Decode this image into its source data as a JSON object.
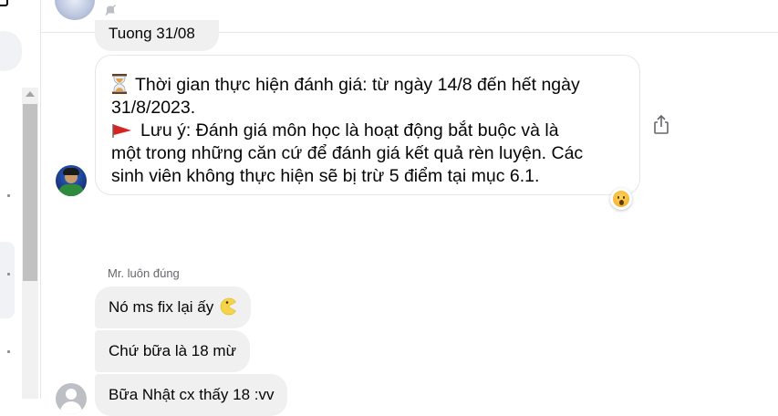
{
  "conversation": {
    "prev_message_partial": "Tuong 31/08"
  },
  "announcement": {
    "line1": "Thời gian thực hiện đánh giá: từ ngày 14/8 đến hết ngày",
    "line2": "31/8/2023.",
    "line3": "Lưu ý: Đánh giá môn học là hoạt động bắt buộc và là",
    "line4": "một trong những căn cứ để đánh giá kết quả rèn luyện. Các",
    "line5": "sinh viên không thực hiện sẽ bị trừ 5 điểm tại mục 6.1.",
    "reaction": "wow"
  },
  "reply_group": {
    "sender_name": "Mr. luôn đúng",
    "messages": [
      {
        "text": "Nó ms fix lại ấy",
        "emoji": "pacman"
      },
      {
        "text": "Chứ bữa là 18 mừ"
      },
      {
        "text": "Bữa Nhật cx thấy 18 :vv"
      }
    ]
  },
  "colors": {
    "bubble_gray": "#f0f0f0",
    "border": "#e4e6eb",
    "secondary_text": "#65676b",
    "flag_red": "#d62424"
  },
  "icons": [
    "hourglass-icon",
    "flag-icon",
    "share-icon",
    "mute-icon",
    "wow-reaction-icon",
    "pacman-emoji-icon"
  ]
}
